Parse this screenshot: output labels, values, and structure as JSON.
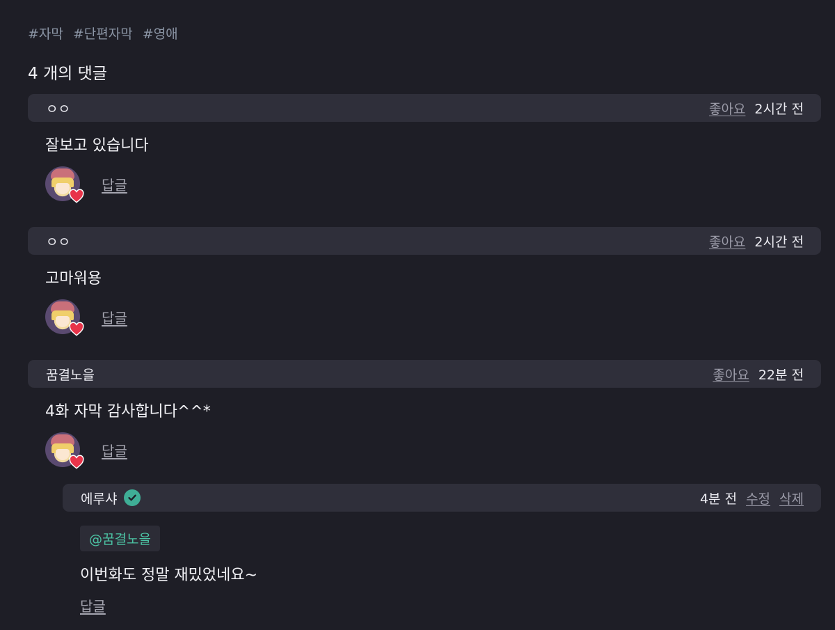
{
  "tags": [
    "#자막",
    "#단편자막",
    "#영애"
  ],
  "comment_count": "4 개의 댓글",
  "comments": [
    {
      "author": "ㅇㅇ",
      "like": "좋아요",
      "time": "2시간 전",
      "body": "잘보고 있습니다",
      "reply": "답글"
    },
    {
      "author": "ㅇㅇ",
      "like": "좋아요",
      "time": "2시간 전",
      "body": "고마워용",
      "reply": "답글"
    },
    {
      "author": "꿈결노을",
      "like": "좋아요",
      "time": "22분 전",
      "body": "4화 자막 감사합니다^^*",
      "reply": "답글"
    }
  ],
  "reply": {
    "author": "에루샤",
    "time": "4분 전",
    "edit": "수정",
    "delete": "삭제",
    "mention": "@꿈결노을",
    "body": "이번화도 정말 재밌었네요~",
    "reply": "답글"
  },
  "colors": {
    "background": "#1e1e26",
    "header_bg": "#2f2f3a",
    "mention": "#4cc3a4",
    "verified": "#3fae96",
    "heart": "#e8344a"
  },
  "icons": [
    "verified-check-icon",
    "heart-icon"
  ]
}
